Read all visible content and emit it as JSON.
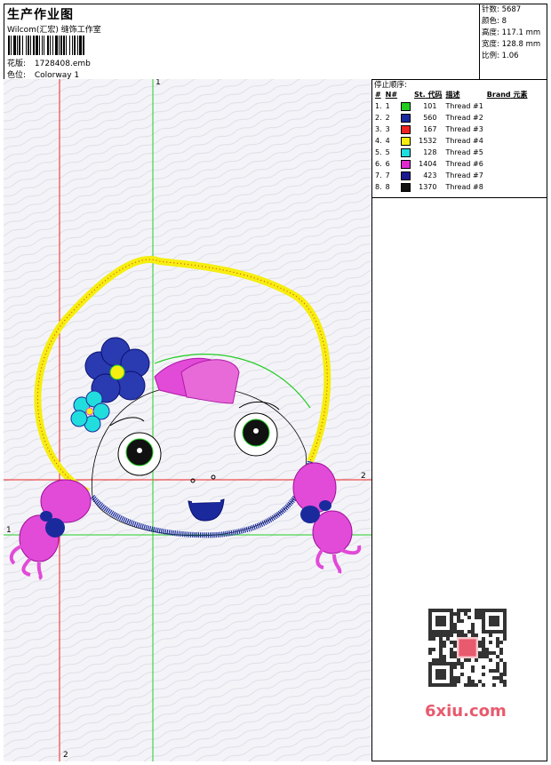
{
  "header": {
    "title": "生产作业图",
    "subtitle": "Wilcom(汇宏) 缝饰工作室",
    "design_label": "花版:",
    "design_value": "1728408.emb",
    "color_label": "色位:",
    "color_value": "Colorway 1"
  },
  "stats": {
    "stitches_label": "针数:",
    "stitches_value": "5687",
    "colors_label": "颜色:",
    "colors_value": "8",
    "height_label": "高度:",
    "height_value": "117.1 mm",
    "width_label": "宽度:",
    "width_value": "128.8 mm",
    "scale_label": "比例:",
    "scale_value": "1.06"
  },
  "stop_sequence": {
    "title": "停止顺序:",
    "headers": [
      "#",
      "N#",
      "St.",
      "代码",
      "描述",
      "Brand",
      "元素"
    ],
    "rows": [
      {
        "idx": "1.",
        "n": "1",
        "code": "101",
        "desc": "Thread #1",
        "color": "#22cc22"
      },
      {
        "idx": "2.",
        "n": "2",
        "code": "560",
        "desc": "Thread #2",
        "color": "#1a2a9c"
      },
      {
        "idx": "3.",
        "n": "3",
        "code": "167",
        "desc": "Thread #3",
        "color": "#ee2222"
      },
      {
        "idx": "4.",
        "n": "4",
        "code": "1532",
        "desc": "Thread #4",
        "color": "#f5ee10"
      },
      {
        "idx": "5.",
        "n": "5",
        "code": "128",
        "desc": "Thread #5",
        "color": "#22dddd"
      },
      {
        "idx": "6.",
        "n": "6",
        "code": "1404",
        "desc": "Thread #6",
        "color": "#e02ad0"
      },
      {
        "idx": "7.",
        "n": "7",
        "code": "423",
        "desc": "Thread #7",
        "color": "#1a1a90"
      },
      {
        "idx": "8.",
        "n": "8",
        "code": "1370",
        "desc": "Thread #8",
        "color": "#111111"
      }
    ]
  },
  "guides": {
    "label_1": "1",
    "label_2": "2"
  },
  "watermark": {
    "site": "6xiu.com"
  }
}
